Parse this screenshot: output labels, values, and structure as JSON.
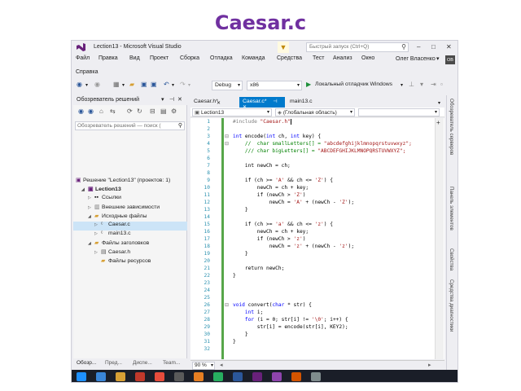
{
  "slide": {
    "title": "Caesar.c"
  },
  "window": {
    "title": "Lection13 - Microsoft Visual Studio",
    "quick_launch_placeholder": "Быстрый запуск (Ctrl+Q)",
    "user": "Олег Власенко",
    "user_badge": "OB"
  },
  "menu": [
    "Файл",
    "Правка",
    "Вид",
    "Проект",
    "Сборка",
    "Отладка",
    "Команда",
    "Средства",
    "Тест",
    "Анализ",
    "Окно"
  ],
  "menu_help": "Справка",
  "toolbar": {
    "config": "Debug",
    "platform": "x86",
    "debugger": "Локальный отладчик Windows"
  },
  "solution_explorer": {
    "title": "Обозреватель решений",
    "search_placeholder": "Обозреватель решений — поиск (",
    "items": [
      "Решение \"Lection13\" (проектов: 1)",
      "Lection13",
      "Ссылки",
      "Внешние зависимости",
      "Исходные файлы",
      "Caesar.c",
      "main13.c",
      "Файлы заголовков",
      "Caesar.h",
      "Файлы ресурсов"
    ],
    "tabs": [
      "Обозр...",
      "Пред...",
      "Диспе...",
      "Team..."
    ]
  },
  "editor": {
    "tabs": [
      "Caesar.h*",
      "Caesar.c*",
      "main13.c"
    ],
    "nav": {
      "project": "Lection13",
      "scope": "(Глобальная область)"
    },
    "zoom": "90 %",
    "line_numbers": [
      "1",
      "2",
      "3",
      "4",
      "5",
      "6",
      "7",
      "8",
      "9",
      "10",
      "11",
      "12",
      "13",
      "14",
      "15",
      "16",
      "17",
      "18",
      "19",
      "20",
      "21",
      "22",
      "23",
      "24",
      "25",
      "26",
      "27",
      "28",
      "29",
      "30",
      "31",
      "32"
    ],
    "code": {
      "l1a": "#include ",
      "l1b": "\"Caesar.h\"",
      "l3a": "int",
      "l3b": " encode(",
      "l3c": "int",
      "l3d": " ch, ",
      "l3e": "int",
      "l3f": " key) {",
      "l4a": "    //  char smallLetters[] = ",
      "l4b": "\"abcdefghijklmnopqrstuvwxyz\";",
      "l5a": "    /// char bigLetters[] = ",
      "l5b": "\"ABCDEFGHIJKLMNOPQRSTUVWXYZ\";",
      "l7": "    int newCh = ch;",
      "l9a": "    if (ch >= ",
      "l9b": "'A'",
      "l9c": " && ch <= ",
      "l9d": "'Z'",
      "l9e": ") {",
      "l10": "        newCh = ch + key;",
      "l11a": "        if (newCh > ",
      "l11b": "'Z'",
      "l11c": ")",
      "l12a": "            newCh = ",
      "l12b": "'A'",
      "l12c": " + (newCh - ",
      "l12d": "'Z'",
      "l12e": ");",
      "l13": "    }",
      "l15a": "    if (ch >= ",
      "l15b": "'a'",
      "l15c": " && ch <= ",
      "l15d": "'z'",
      "l15e": ") {",
      "l16": "        newCh = ch + key;",
      "l17a": "        if (newCh > ",
      "l17b": "'z'",
      "l17c": ")",
      "l18a": "            newCh = ",
      "l18b": "'z'",
      "l18c": " + (newCh - ",
      "l18d": "'z'",
      "l18e": ");",
      "l19": "    }",
      "l21": "    return newCh;",
      "l22": "}",
      "l26a": "void",
      "l26b": " convert(",
      "l26c": "char",
      "l26d": " * str) {",
      "l27a": "    ",
      "l27b": "int",
      "l27c": " i;",
      "l28a": "    ",
      "l28b": "for",
      "l28c": " (i = 0; str[i] != ",
      "l28d": "'\\0'",
      "l28e": "; i++) {",
      "l29": "        str[i] = encode(str[i], KEY2);",
      "l30": "    }",
      "l31": "}"
    }
  },
  "right_rail": [
    "Обозреватель серверов",
    "Панель элементов",
    "Свойства",
    "Средства диагностики"
  ],
  "colors": {
    "accent": "#007acc",
    "title": "#7030a0",
    "keyword": "#0000ff",
    "comment": "#008000",
    "string": "#a31515"
  }
}
